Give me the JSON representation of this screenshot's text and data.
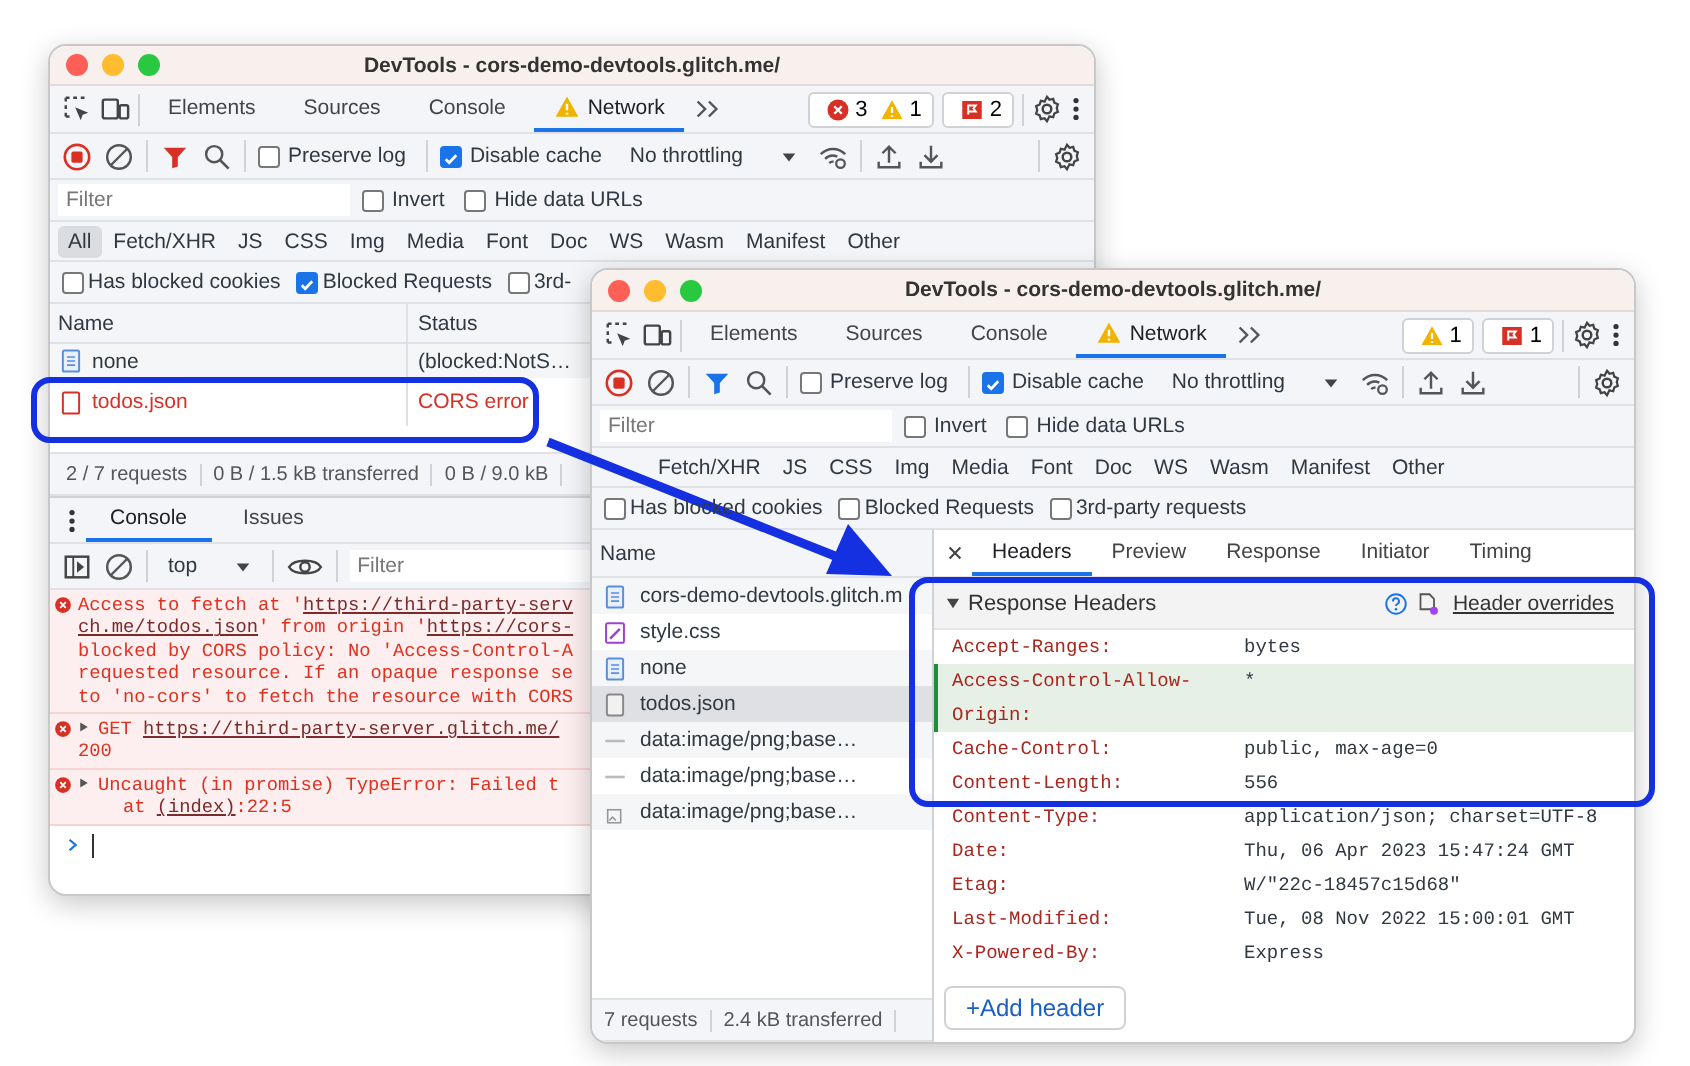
{
  "windows": [
    {
      "kind": "console",
      "title": "DevTools - cors-demo-devtools.glitch.me/",
      "tabs": [
        {
          "label": "Elements",
          "selected": false,
          "warning": false
        },
        {
          "label": "Sources",
          "selected": false,
          "warning": false
        },
        {
          "label": "Console",
          "selected": false,
          "warning": false
        },
        {
          "label": "Network",
          "selected": true,
          "warning": true
        }
      ],
      "counters": [
        {
          "kind": "error",
          "count": "3"
        },
        {
          "kind": "warning",
          "count": "1"
        },
        {
          "kind": "issue",
          "count": "2"
        }
      ],
      "preserve_log": {
        "label": "Preserve log",
        "checked": false
      },
      "disable_cache": {
        "label": "Disable cache",
        "checked": true
      },
      "throttling": "No throttling",
      "filter": {
        "placeholder": "Filter"
      },
      "filter_checks": [
        {
          "label": "Invert",
          "checked": false
        },
        {
          "label": "Hide data URLs",
          "checked": false
        }
      ],
      "types": [
        {
          "label": "All",
          "selected": true
        },
        {
          "label": "Fetch/XHR",
          "selected": false
        },
        {
          "label": "JS",
          "selected": false
        },
        {
          "label": "CSS",
          "selected": false
        },
        {
          "label": "Img",
          "selected": false
        },
        {
          "label": "Media",
          "selected": false
        },
        {
          "label": "Font",
          "selected": false
        },
        {
          "label": "Doc",
          "selected": false
        },
        {
          "label": "WS",
          "selected": false
        },
        {
          "label": "Wasm",
          "selected": false
        },
        {
          "label": "Manifest",
          "selected": false
        },
        {
          "label": "Other",
          "selected": false
        }
      ],
      "options": [
        {
          "label": "Has blocked cookies",
          "checked": false
        },
        {
          "label": "Blocked Requests",
          "checked": true
        },
        {
          "label": "3rd-",
          "checked": false
        }
      ],
      "columns": [
        "Name",
        "Status"
      ],
      "rows": [
        {
          "name": "none",
          "status": "(blocked:NotS…",
          "error": false
        },
        {
          "name": "todos.json",
          "status": "CORS error",
          "error": true
        }
      ],
      "status_bar": [
        "2 / 7 requests",
        "0 B / 1.5 kB transferred",
        "0 B / 9.0 kB"
      ],
      "drawer_tabs": [
        {
          "label": "Console",
          "selected": true
        },
        {
          "label": "Issues",
          "selected": false
        }
      ],
      "context": "top",
      "console_filter": {
        "placeholder": "Filter"
      },
      "messages": [
        {
          "kind": "error",
          "expandable": false,
          "lines": [
            [
              {
                "text": "Access to fetch at '",
                "link": false
              },
              {
                "text": "https://third-party-serv",
                "link": true
              }
            ],
            [
              {
                "text": "ch.me/todos.json",
                "link": true
              },
              {
                "text": "' from origin '",
                "link": false
              },
              {
                "text": "https://cors-",
                "link": true
              }
            ],
            [
              {
                "text": "blocked by CORS policy: No 'Access-Control-A",
                "link": false
              }
            ],
            [
              {
                "text": "requested resource. If an opaque response se",
                "link": false
              }
            ],
            [
              {
                "text": "to 'no-cors' to fetch the resource with CORS",
                "link": false
              }
            ]
          ]
        },
        {
          "kind": "error",
          "expandable": true,
          "lines": [
            [
              {
                "text": "GET ",
                "link": false
              },
              {
                "text": "https://third-party-server.glitch.me/",
                "link": true
              }
            ],
            [
              {
                "text": "200",
                "link": false
              }
            ]
          ]
        },
        {
          "kind": "error",
          "expandable": true,
          "lines": [
            [
              {
                "text": "Uncaught (in promise) TypeError: Failed t",
                "link": false
              }
            ],
            [
              {
                "text": "    at ",
                "link": false
              },
              {
                "text": "(index)",
                "link": true
              },
              {
                "text": ":22:5",
                "link": false
              }
            ]
          ]
        }
      ]
    },
    {
      "kind": "detail",
      "title": "DevTools - cors-demo-devtools.glitch.me/",
      "tabs": [
        {
          "label": "Elements",
          "selected": false,
          "warning": false
        },
        {
          "label": "Sources",
          "selected": false,
          "warning": false
        },
        {
          "label": "Console",
          "selected": false,
          "warning": false
        },
        {
          "label": "Network",
          "selected": true,
          "warning": true
        }
      ],
      "counters": [
        {
          "kind": "warning",
          "count": "1"
        },
        {
          "kind": "issue",
          "count": "1"
        }
      ],
      "preserve_log": {
        "label": "Preserve log",
        "checked": false
      },
      "disable_cache": {
        "label": "Disable cache",
        "checked": true
      },
      "throttling": "No throttling",
      "filter": {
        "placeholder": "Filter"
      },
      "filter_checks": [
        {
          "label": "Invert",
          "checked": false
        },
        {
          "label": "Hide data URLs",
          "checked": false
        }
      ],
      "types": [
        {
          "label": "Fetch/XHR",
          "selected": false
        },
        {
          "label": "JS",
          "selected": false
        },
        {
          "label": "CSS",
          "selected": false
        },
        {
          "label": "Img",
          "selected": false
        },
        {
          "label": "Media",
          "selected": false
        },
        {
          "label": "Font",
          "selected": false
        },
        {
          "label": "Doc",
          "selected": false
        },
        {
          "label": "WS",
          "selected": false
        },
        {
          "label": "Wasm",
          "selected": false
        },
        {
          "label": "Manifest",
          "selected": false
        },
        {
          "label": "Other",
          "selected": false
        }
      ],
      "options": [
        {
          "label": "Has blocked cookies",
          "checked": false
        },
        {
          "label": "Blocked Requests",
          "checked": false
        },
        {
          "label": "3rd-party requests",
          "checked": false
        }
      ],
      "list_header": "Name",
      "requests": [
        {
          "name": "cors-demo-devtools.glitch.m",
          "kind": "document",
          "selected": false
        },
        {
          "name": "style.css",
          "kind": "stylesheet",
          "selected": false
        },
        {
          "name": "none",
          "kind": "document",
          "selected": false
        },
        {
          "name": "todos.json",
          "kind": "fetch",
          "selected": true
        },
        {
          "name": "data:image/png;base…",
          "kind": "data",
          "selected": false
        },
        {
          "name": "data:image/png;base…",
          "kind": "data",
          "selected": false
        },
        {
          "name": "data:image/png;base…",
          "kind": "image",
          "selected": false
        }
      ],
      "status_bar": [
        "7 requests",
        "2.4 kB transferred"
      ],
      "detail_tabs": [
        {
          "label": "Headers",
          "selected": true
        },
        {
          "label": "Preview",
          "selected": false
        },
        {
          "label": "Response",
          "selected": false
        },
        {
          "label": "Initiator",
          "selected": false
        },
        {
          "label": "Timing",
          "selected": false
        }
      ],
      "section": {
        "title": "Response Headers",
        "expanded": true,
        "link": "Header overrides"
      },
      "headers": [
        {
          "name": "Accept-Ranges:",
          "value": "bytes",
          "highlighted": false
        },
        {
          "name": "Access-Control-Allow-Origin:",
          "value": "*",
          "highlighted": true
        },
        {
          "name": "Cache-Control:",
          "value": "public, max-age=0",
          "highlighted": false
        },
        {
          "name": "Content-Length:",
          "value": "556",
          "highlighted": false
        },
        {
          "name": "Content-Type:",
          "value": "application/json; charset=UTF-8",
          "highlighted": false
        },
        {
          "name": "Date:",
          "value": "Thu, 06 Apr 2023 15:47:24 GMT",
          "highlighted": false
        },
        {
          "name": "Etag:",
          "value": "W/\"22c-18457c15d68\"",
          "highlighted": false
        },
        {
          "name": "Last-Modified:",
          "value": "Tue, 08 Nov 2022 15:00:01 GMT",
          "highlighted": false
        },
        {
          "name": "X-Powered-By:",
          "value": "Express",
          "highlighted": false
        }
      ],
      "add_button": "+Add header"
    }
  ]
}
